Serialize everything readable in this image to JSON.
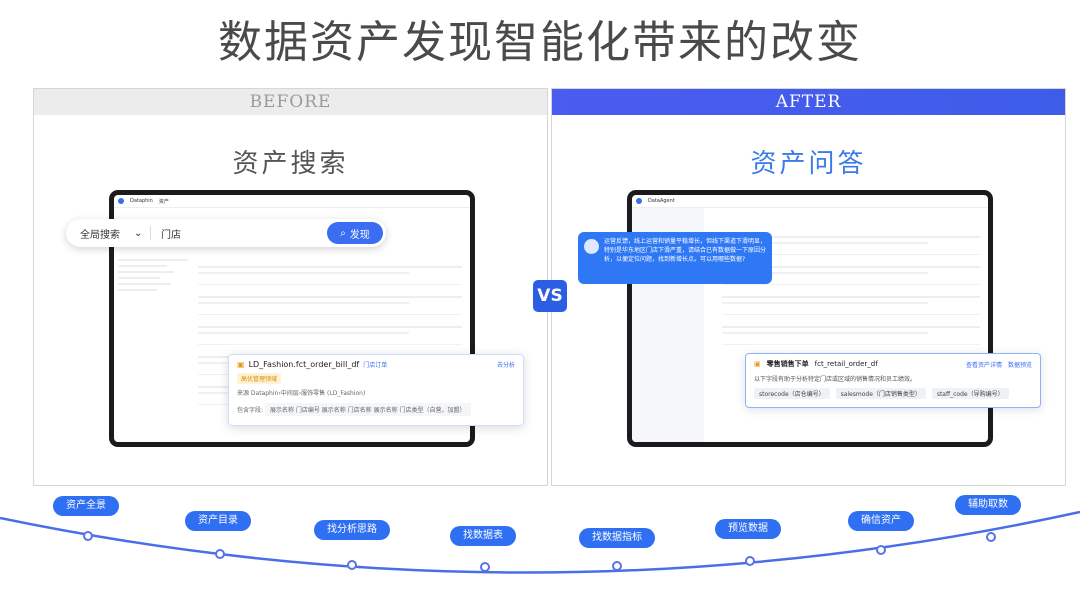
{
  "title": "数据资产发现智能化带来的改变",
  "before": {
    "header": "BEFORE",
    "subtitle": "资产搜索",
    "app": {
      "brand": "Dataphin",
      "section": "资产",
      "scope": "全局搜索",
      "query": "门店",
      "search_btn": "发现",
      "result": {
        "name": "LD_Fashion.fct_order_bill_df",
        "badge": "门店订单",
        "tag": "高优管理领域",
        "source": "来源  Dataphin›中间层›服饰零售 (LD_Fashion)",
        "cols_label": "包含字段:",
        "cols": "展示名称 门店编号    展示名称 门店名称    展示名称 门店类型（自营，加盟）",
        "action": "去分析"
      }
    }
  },
  "after": {
    "header": "AFTER",
    "subtitle": "资产问答",
    "app": {
      "brand": "DataAgent",
      "question": "运营反馈，线上运营和销量平稳增长，但线下渠道下滑明显，特别是华东地区门店下滑严重，请结合已有数据做一下原因分析，以便定位问题，找到新增长点。可以用哪些数据?",
      "result": {
        "name": "零售销售下单",
        "table": "fct_retail_order_df",
        "action1": "查看资产详情",
        "action2": "数据预览",
        "desc": "以下字段有助于分析特定门店或区域的销售情况和员工绩效。",
        "chips": [
          "storecode（店仓编号）",
          "salesmode（门店销售类型）",
          "staff_code（导购编号）"
        ]
      }
    }
  },
  "vs": "VS",
  "steps": [
    "资产全景",
    "资产目录",
    "找分析思路",
    "找数据表",
    "找数据指标",
    "预览数据",
    "确信资产",
    "辅助取数"
  ],
  "colors": {
    "accent": "#2f6ff2",
    "before_head": "#ececec",
    "after_head": "#4b5cf0"
  }
}
